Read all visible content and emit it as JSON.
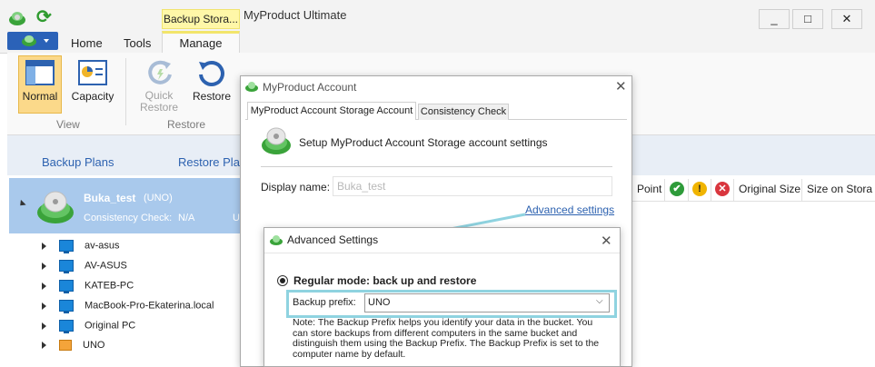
{
  "window": {
    "title": "MyProduct Ultimate",
    "context_tab": "Backup Stora...",
    "controls": {
      "minimize": "_",
      "maximize": "□",
      "close": "✕"
    }
  },
  "ribbon": {
    "tabs": {
      "home": "Home",
      "tools": "Tools",
      "manage": "Manage"
    },
    "view_group": {
      "label": "View",
      "normal": "Normal",
      "capacity": "Capacity"
    },
    "restore_group": {
      "label": "Restore",
      "quick_restore_line1": "Quick",
      "quick_restore_line2": "Restore",
      "restore": "Restore"
    }
  },
  "nav": {
    "backup_plans": "Backup Plans",
    "restore_plans": "Restore Plans"
  },
  "storage": {
    "name": "Buka_test",
    "tag": "(UNO)",
    "consistency_label": "Consistency Check:",
    "consistency_value": "N/A",
    "extra": "U",
    "computers": [
      {
        "name": "av-asus",
        "icon": "computer-icon"
      },
      {
        "name": "AV-ASUS",
        "icon": "computer-icon"
      },
      {
        "name": "KATEB-PC",
        "icon": "computer-icon"
      },
      {
        "name": "MacBook-Pro-Ekaterina.local",
        "icon": "computer-icon"
      },
      {
        "name": "Original PC",
        "icon": "computer-icon"
      },
      {
        "name": "UNO",
        "icon": "home-icon"
      }
    ]
  },
  "columns": {
    "point": "Point",
    "original_size": "Original Size",
    "size_on_storage": "Size on Stora"
  },
  "status_icons": {
    "ok": "✔",
    "warning": "!",
    "error": "✕"
  },
  "account_dialog": {
    "title": "MyProduct Account",
    "tab_storage": "MyProduct Account Storage Account",
    "tab_consistency": "Consistency Check",
    "setup_text": "Setup MyProduct Account Storage account settings",
    "display_name_label": "Display name:",
    "display_name_value": "Buka_test",
    "advanced_link": "Advanced settings"
  },
  "advanced_dialog": {
    "title": "Advanced Settings",
    "mode_label": "Regular mode: back up and restore",
    "prefix_label": "Backup prefix:",
    "prefix_value": "UNO",
    "note": "Note: The Backup Prefix helps you identify your data in the bucket. You can store backups from different computers in the same bucket and distinguish them using the Backup Prefix. The Backup Prefix is set to the computer name by default."
  },
  "colors": {
    "accent": "#2d62b0",
    "selection": "#a9c9ec",
    "highlight": "#8fd3e0",
    "context_tab": "#fff7a8"
  }
}
